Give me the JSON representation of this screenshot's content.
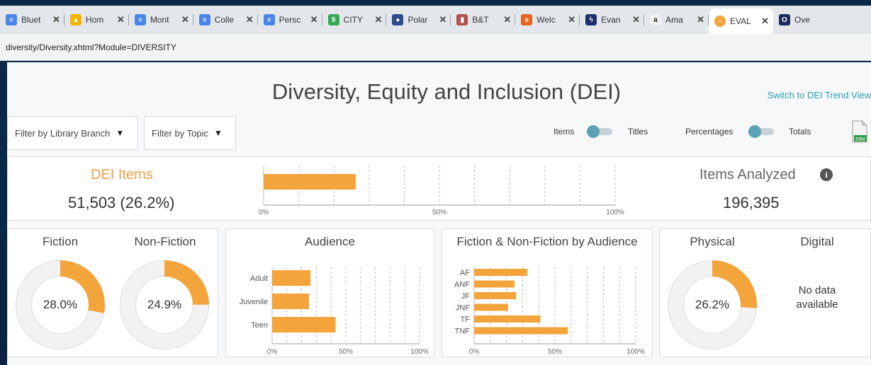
{
  "browser": {
    "tabs": [
      {
        "label": "Bluet",
        "icon": "docs-icon",
        "color": "#4a86e8",
        "glyph": "≡",
        "active": false
      },
      {
        "label": "Hom",
        "icon": "drive-icon",
        "color": "#f4b400",
        "glyph": "▲",
        "active": false
      },
      {
        "label": "Mont",
        "icon": "docs-icon",
        "color": "#4a86e8",
        "glyph": "≡",
        "active": false
      },
      {
        "label": "Colle",
        "icon": "docs-icon",
        "color": "#4a86e8",
        "glyph": "≡",
        "active": false
      },
      {
        "label": "Persc",
        "icon": "docs-icon",
        "color": "#4a86e8",
        "glyph": "≡",
        "active": false
      },
      {
        "label": "CITY",
        "icon": "calendar-icon",
        "color": "#34a853",
        "glyph": "9",
        "active": false
      },
      {
        "label": "Polar",
        "icon": "globe-icon",
        "color": "#2b4b8c",
        "glyph": "●",
        "active": false
      },
      {
        "label": "B&T",
        "icon": "book-icon",
        "color": "#b4504a",
        "glyph": "▮",
        "active": false
      },
      {
        "label": "Welc",
        "icon": "e-icon",
        "color": "#e8641b",
        "glyph": "e",
        "active": false
      },
      {
        "label": "Evan",
        "icon": "bolt-icon",
        "color": "#1f2f6b",
        "glyph": "ϟ",
        "active": false
      },
      {
        "label": "Ama",
        "icon": "amazon-icon",
        "color": "#f1f1f1",
        "glyph": "a",
        "active": false
      },
      {
        "label": "EVAL",
        "icon": "ring-icon",
        "color": "#f2a33a",
        "glyph": "○",
        "active": true
      },
      {
        "label": "Ove",
        "icon": "o-icon",
        "color": "#1a2b5c",
        "glyph": "O",
        "active": false
      }
    ],
    "address": "diversity/Diversity.xhtml?Module=DIVERSITY"
  },
  "header": {
    "title": "Diversity, Equity and Inclusion (DEI)",
    "switch_link": "Switch to DEI Trend View"
  },
  "filters": {
    "branch": "Filter by Library Branch",
    "topic": "Filter by Topic"
  },
  "toggles": {
    "items": "Items",
    "titles": "Titles",
    "percentages": "Percentages",
    "totals": "Totals"
  },
  "csv_label": "CSV",
  "kpis": {
    "dei_items_title": "DEI Items",
    "dei_items_value": "51,503 (26.2%)",
    "analyzed_title": "Items Analyzed",
    "analyzed_value": "196,395"
  },
  "colors": {
    "accent": "#f3a43b",
    "title_orange": "#f0a04a",
    "donut_bg": "#f2f2f2",
    "grid": "#bdbdbd"
  },
  "panels": {
    "fiction": {
      "title": "Fiction",
      "label": "28.0%",
      "value": 28.0
    },
    "nonfiction": {
      "title": "Non-Fiction",
      "label": "24.9%",
      "value": 24.9
    },
    "audience_title": "Audience",
    "fnf_title": "Fiction & Non-Fiction by Audience",
    "physical": {
      "title": "Physical",
      "label": "26.2%",
      "value": 26.2
    },
    "digital": {
      "title": "Digital",
      "nodata": "No data\navailable"
    }
  },
  "chart_data": [
    {
      "type": "bar",
      "orientation": "horizontal",
      "categories": [
        ""
      ],
      "values": [
        26.2
      ],
      "xlim": [
        0,
        100
      ],
      "ticks": [
        "0%",
        "50%",
        "100%"
      ],
      "grid": true
    },
    {
      "type": "bar",
      "orientation": "horizontal",
      "title": "Audience",
      "categories": [
        "Adult",
        "Juvenile",
        "Teen"
      ],
      "values": [
        26,
        25,
        43
      ],
      "xlim": [
        0,
        100
      ],
      "ticks": [
        "0%",
        "50%",
        "100%"
      ],
      "grid": true
    },
    {
      "type": "bar",
      "orientation": "horizontal",
      "title": "Fiction & Non-Fiction by Audience",
      "categories": [
        "AF",
        "ANF",
        "JF",
        "JNF",
        "TF",
        "TNF"
      ],
      "values": [
        33,
        25,
        26,
        21,
        41,
        58
      ],
      "xlim": [
        0,
        100
      ],
      "ticks": [
        "0%",
        "50%",
        "100%"
      ],
      "grid": true
    }
  ]
}
